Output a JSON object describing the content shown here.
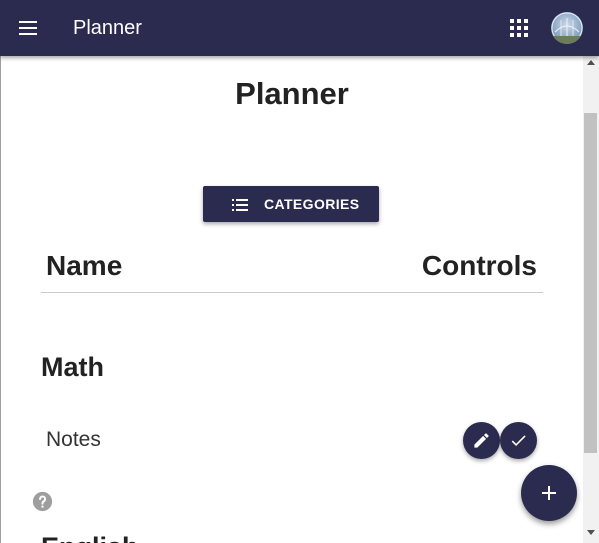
{
  "appbar": {
    "menu_icon": "menu-icon",
    "title": "Planner",
    "apps_icon": "apps-icon",
    "avatar_icon": "avatar"
  },
  "page": {
    "title": "Planner",
    "categories_button": {
      "label": "CATEGORIES",
      "icon": "list-icon"
    }
  },
  "table": {
    "columns": [
      "Name",
      "Controls"
    ]
  },
  "categories": [
    {
      "title": "Math",
      "items": [
        {
          "name": "Notes",
          "controls": [
            "edit-icon",
            "check-icon"
          ]
        }
      ]
    },
    {
      "title": "English",
      "items": []
    }
  ],
  "help_icon": "help-icon",
  "fab_icon": "add-icon",
  "colors": {
    "primary": "#2a2b4f",
    "text": "#222222",
    "divider": "#cccccc",
    "help_icon": "#9e9e9e"
  }
}
